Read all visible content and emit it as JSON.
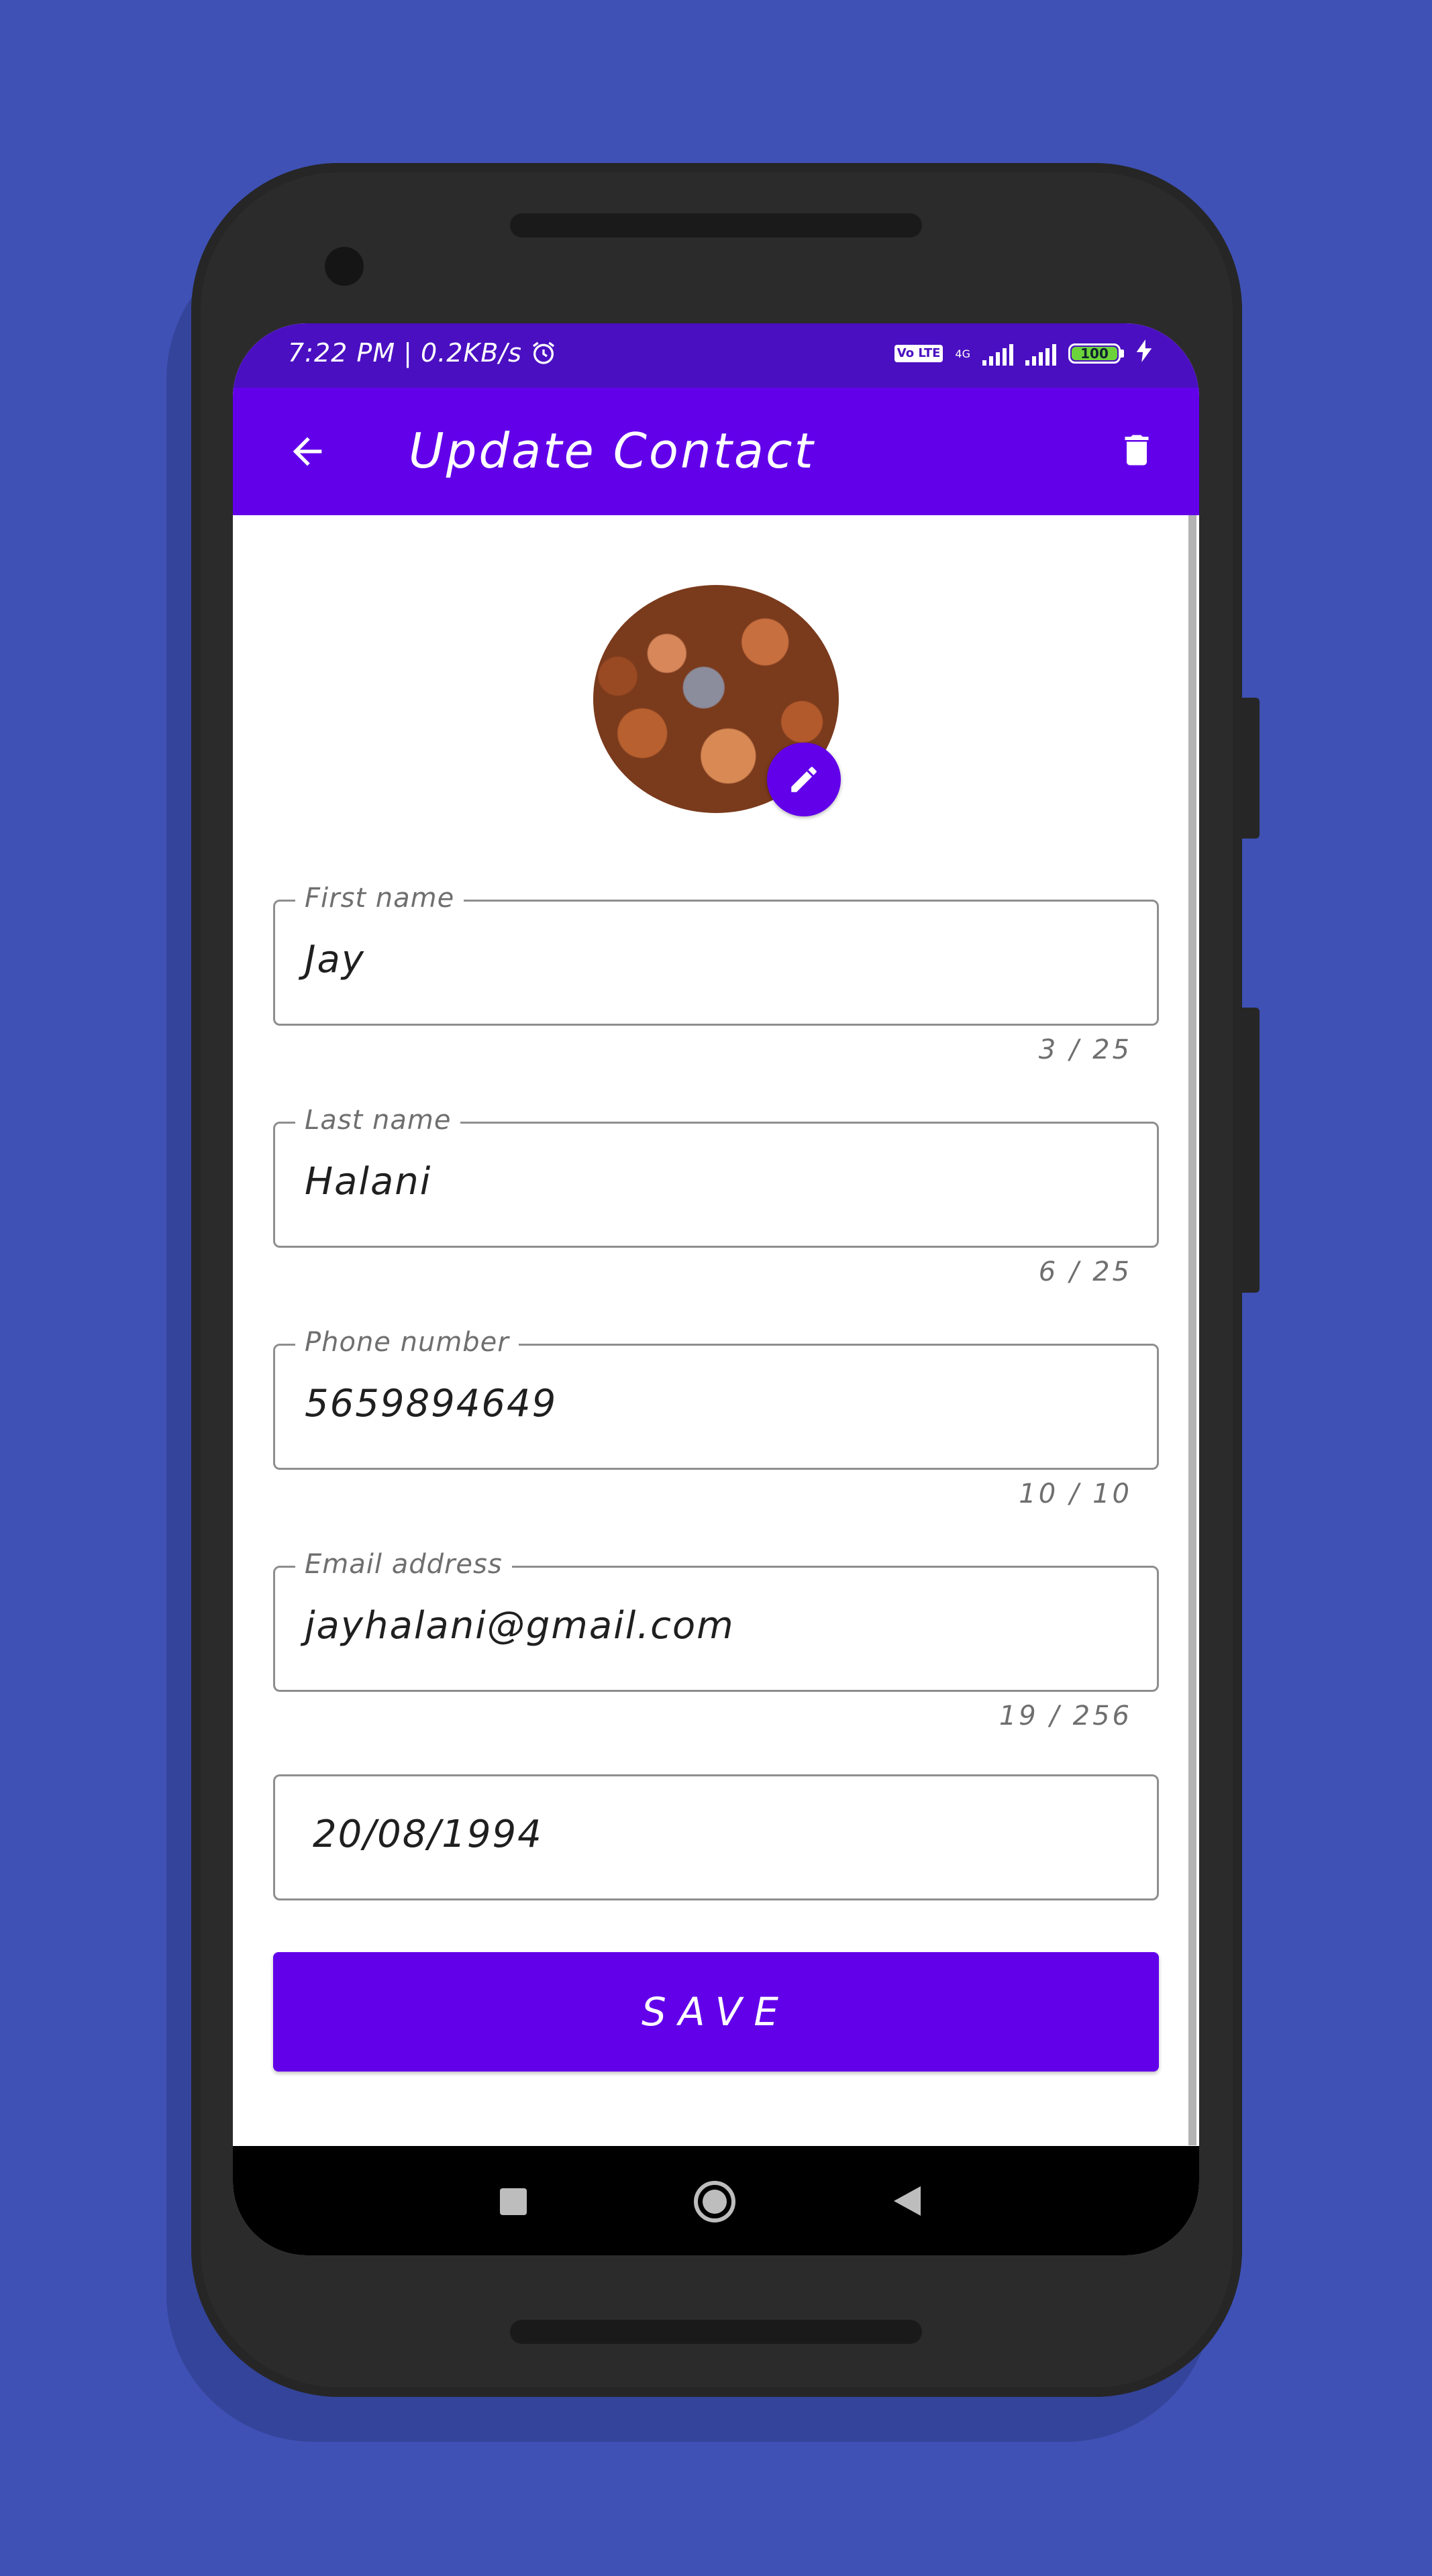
{
  "status_bar": {
    "time": "7:22 PM",
    "separator": "|",
    "net_speed": "0.2KB/s",
    "volte_badge": "Vo LTE",
    "network_type": "4G",
    "battery_level": "100"
  },
  "appbar": {
    "title": "Update Contact"
  },
  "form": {
    "first_name": {
      "label": "First name",
      "value": "Jay",
      "counter": "3 / 25"
    },
    "last_name": {
      "label": "Last name",
      "value": "Halani",
      "counter": "6 / 25"
    },
    "phone": {
      "label": "Phone number",
      "value": "5659894649",
      "counter": "10 / 10"
    },
    "email": {
      "label": "Email address",
      "value": "jayhalani@gmail.com",
      "counter": "19 / 256"
    },
    "dob": {
      "value": "20/08/1994"
    }
  },
  "save_button": {
    "label": "SAVE"
  },
  "colors": {
    "background": "#3f51b5",
    "primary": "#6200ea",
    "status_bar": "#4a0fc1"
  }
}
